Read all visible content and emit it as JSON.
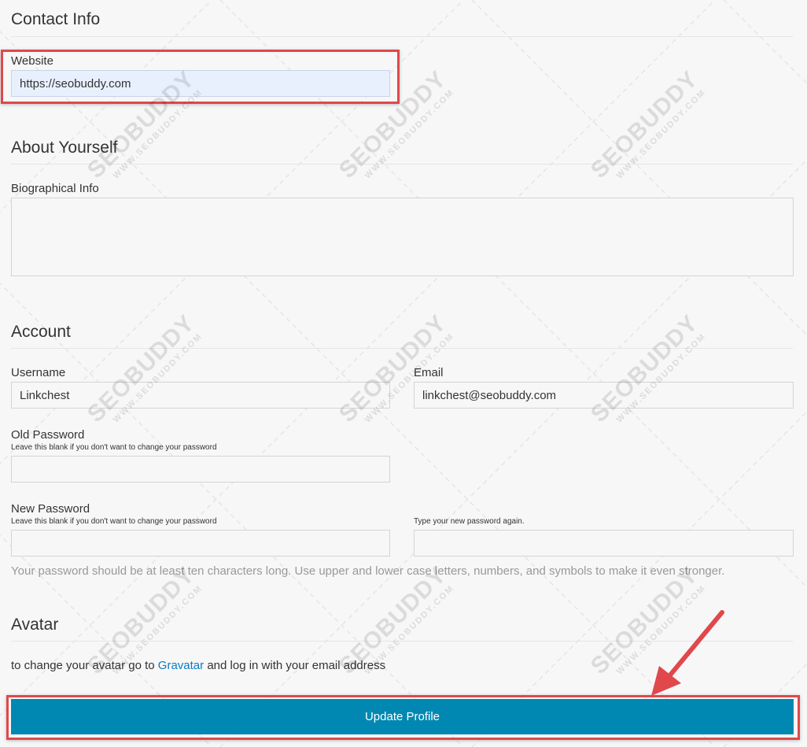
{
  "contact": {
    "section_title": "Contact Info",
    "website_label": "Website",
    "website_value": "https://seobuddy.com"
  },
  "about": {
    "section_title": "About Yourself",
    "bio_label": "Biographical Info",
    "bio_value": ""
  },
  "account": {
    "section_title": "Account",
    "username_label": "Username",
    "username_value": "Linkchest",
    "email_label": "Email",
    "email_value": "linkchest@seobuddy.com",
    "old_password_label": "Old Password",
    "old_password_hint": "Leave this blank if you don't want to change your password",
    "new_password_label": "New Password",
    "new_password_hint": "Leave this blank if you don't want to change your password",
    "confirm_password_hint": "Type your new password again.",
    "password_strength_note": "Your password should be at least ten characters long. Use upper and lower case letters, numbers, and symbols to make it even stronger."
  },
  "avatar": {
    "section_title": "Avatar",
    "text_before": "to change your avatar go to ",
    "link_text": "Gravatar",
    "text_after": " and log in with your email address"
  },
  "actions": {
    "update_button_label": "Update Profile"
  },
  "watermark": {
    "brand": "SEOBUDDY",
    "url": "WWW.SEOBUDDY.COM"
  },
  "colors": {
    "accent_button": "#0088b2",
    "highlight": "#e0484b",
    "link": "#0a7bc2"
  }
}
